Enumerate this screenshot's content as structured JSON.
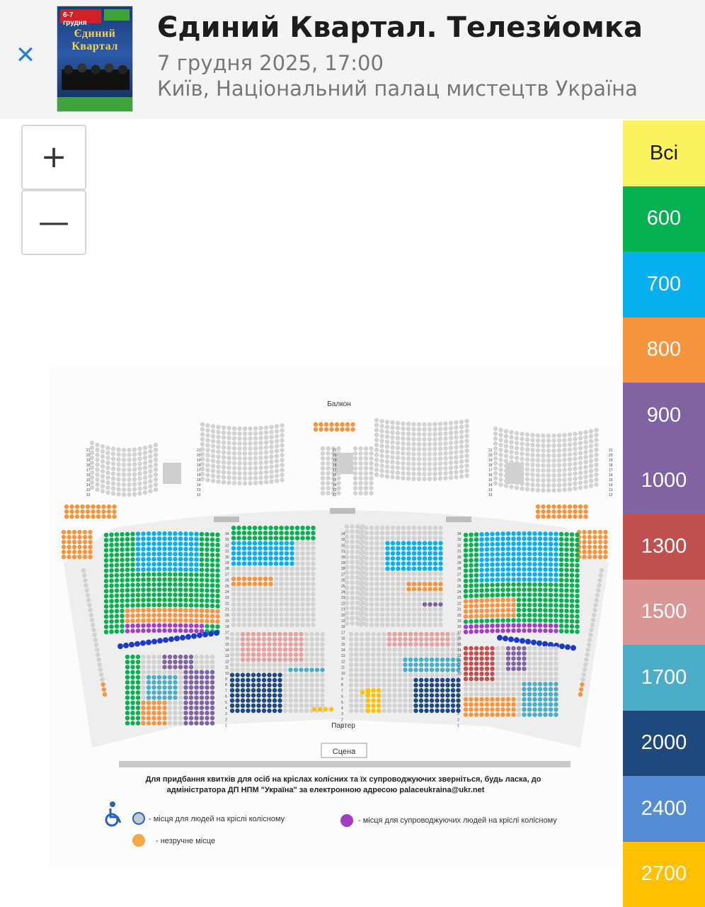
{
  "header": {
    "close_icon": "close-icon",
    "title": "Єдиний Квартал. Телезйомка",
    "date": "7 грудня 2025, 17:00",
    "venue": "Київ, Національний палац мистецтв Україна",
    "poster": {
      "date_text": "6-7 грудня",
      "title_text": "Єдиний Квартал"
    }
  },
  "zoom": {
    "in_label": "+",
    "out_label": "—"
  },
  "prices": [
    {
      "label": "Всі",
      "color": "#fbf35e",
      "text_color": "#1d1d1d"
    },
    {
      "label": "600",
      "color": "#04b050",
      "text_color": "#ffffff"
    },
    {
      "label": "700",
      "color": "#06b0ef",
      "text_color": "#ffffff"
    },
    {
      "label": "800",
      "color": "#f7953f",
      "text_color": "#ffffff"
    },
    {
      "label": "900",
      "color": "#8064a2",
      "text_color": "#ffffff"
    },
    {
      "label": "1000",
      "color": "#8064a2",
      "text_color": "#ffffff"
    },
    {
      "label": "1300",
      "color": "#c0504d",
      "text_color": "#ffffff"
    },
    {
      "label": "1500",
      "color": "#d99694",
      "text_color": "#ffffff"
    },
    {
      "label": "1700",
      "color": "#4badc6",
      "text_color": "#ffffff"
    },
    {
      "label": "2000",
      "color": "#1f497d",
      "text_color": "#ffffff"
    },
    {
      "label": "2400",
      "color": "#548dd4",
      "text_color": "#ffffff"
    },
    {
      "label": "2700",
      "color": "#ffc000",
      "text_color": "#ffffff"
    }
  ],
  "map": {
    "balcony_label": "Балкон",
    "parterre_label": "Партер",
    "stage_label": "Сцена",
    "notice_line1": "Для придбання квитків для осіб на кріслах колісних та їх супроводжуючих зверніться, будь ласка, до",
    "notice_line2": "адміністратора  ДП НПМ \"Україна\" за електронною адресою palaceukraina@ukr.net",
    "legend_wheelchair": "- місця для людей на кріслі колісному",
    "legend_companion": "- місця для супроводжуючих людей на кріслі колісному",
    "legend_uncomfortable": "- незручне місце",
    "row_numbers_balcony": [
      "21",
      "20",
      "19",
      "18",
      "17",
      "16",
      "15",
      "14",
      "13",
      "12"
    ],
    "row_numbers_parterre": [
      "34",
      "33",
      "32",
      "31",
      "30",
      "29",
      "28",
      "27",
      "26",
      "25",
      "24",
      "23",
      "22",
      "21",
      "20",
      "19",
      "18",
      "17",
      "16",
      "15",
      "14",
      "13",
      "12",
      "11",
      "10",
      "9",
      "8",
      "7",
      "6",
      "5",
      "4",
      "3",
      "2",
      "1"
    ]
  }
}
